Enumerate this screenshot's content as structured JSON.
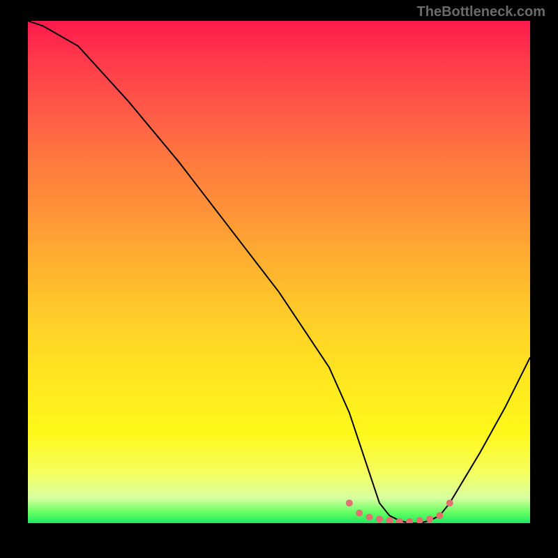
{
  "watermark": "TheBottleneck.com",
  "chart_data": {
    "type": "line",
    "title": "",
    "xlabel": "",
    "ylabel": "",
    "xlim": [
      0,
      100
    ],
    "ylim": [
      0,
      100
    ],
    "series": [
      {
        "name": "curve",
        "x": [
          0,
          3,
          10,
          20,
          30,
          40,
          50,
          60,
          64,
          68,
          70,
          72,
          74,
          76,
          78,
          80,
          82,
          84,
          90,
          95,
          100
        ],
        "values": [
          100,
          99,
          95,
          84,
          72,
          59,
          46,
          31,
          22,
          10,
          4,
          1.5,
          0.5,
          0.0,
          0.0,
          0.5,
          1.5,
          4,
          14,
          23,
          33
        ]
      }
    ],
    "markers": {
      "name": "optimum-dots",
      "color": "#e27070",
      "x": [
        64,
        66,
        68,
        70,
        72,
        74,
        76,
        78,
        80,
        82,
        84
      ],
      "values": [
        4,
        2,
        1.2,
        0.8,
        0.5,
        0.3,
        0.3,
        0.5,
        0.8,
        1.5,
        4
      ]
    }
  }
}
